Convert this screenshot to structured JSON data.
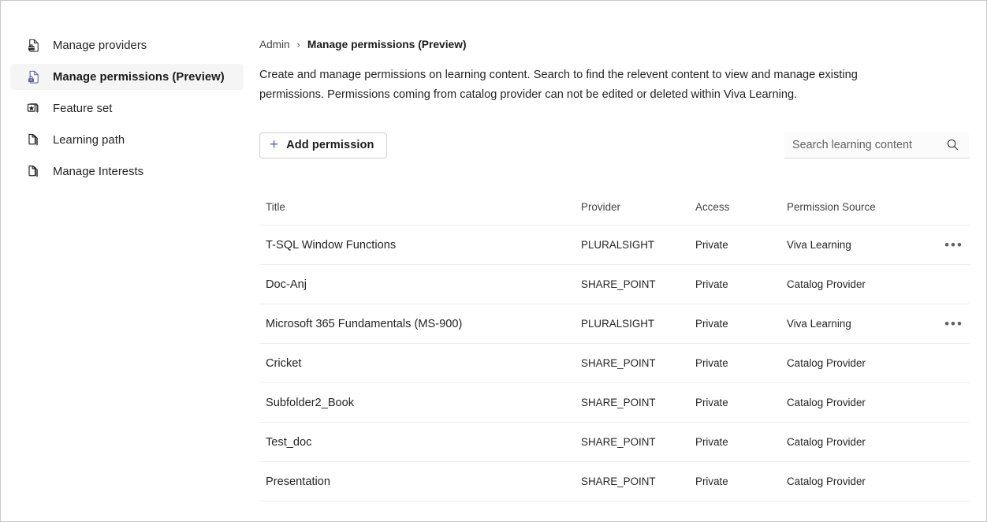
{
  "sidebar": {
    "items": [
      {
        "label": "Manage providers",
        "icon": "document-briefcase-icon",
        "selected": false
      },
      {
        "label": "Manage permissions (Preview)",
        "icon": "document-lock-icon",
        "selected": true
      },
      {
        "label": "Feature set",
        "icon": "cards-star-icon",
        "selected": false
      },
      {
        "label": "Learning path",
        "icon": "document-stack-icon",
        "selected": false
      },
      {
        "label": "Manage Interests",
        "icon": "document-stack-icon",
        "selected": false
      }
    ]
  },
  "breadcrumb": {
    "parent": "Admin",
    "separator": "›",
    "current": "Manage permissions (Preview)"
  },
  "description": "Create and manage permissions on learning content. Search to find the relevent content to view and manage existing permissions. Permissions coming from catalog provider can not be edited or deleted within Viva Learning.",
  "toolbar": {
    "add_permission_label": "Add permission",
    "add_permission_icon": "plus-icon",
    "search_placeholder": "Search learning content",
    "search_value": "",
    "search_icon": "search-icon"
  },
  "table": {
    "columns": [
      "Title",
      "Provider",
      "Access",
      "Permission Source"
    ],
    "rows": [
      {
        "title": "T-SQL Window Functions",
        "provider": "PLURALSIGHT",
        "access": "Private",
        "source": "Viva Learning",
        "has_menu": true
      },
      {
        "title": "Doc-Anj",
        "provider": "SHARE_POINT",
        "access": "Private",
        "source": "Catalog Provider",
        "has_menu": false
      },
      {
        "title": "Microsoft 365 Fundamentals (MS-900)",
        "provider": "PLURALSIGHT",
        "access": "Private",
        "source": "Viva Learning",
        "has_menu": true
      },
      {
        "title": "Cricket",
        "provider": "SHARE_POINT",
        "access": "Private",
        "source": "Catalog Provider",
        "has_menu": false
      },
      {
        "title": "Subfolder2_Book",
        "provider": "SHARE_POINT",
        "access": "Private",
        "source": "Catalog Provider",
        "has_menu": false
      },
      {
        "title": "Test_doc",
        "provider": "SHARE_POINT",
        "access": "Private",
        "source": "Catalog Provider",
        "has_menu": false
      },
      {
        "title": "Presentation",
        "provider": "SHARE_POINT",
        "access": "Private",
        "source": "Catalog Provider",
        "has_menu": false
      }
    ],
    "row_menu_glyph": "•••"
  },
  "colors": {
    "accent": "#5b5fc7",
    "icon_purple": "#6264a7",
    "text_primary": "#242424",
    "text_secondary": "#424242",
    "selected_bg": "#f5f5f5",
    "divider": "#ededed"
  }
}
